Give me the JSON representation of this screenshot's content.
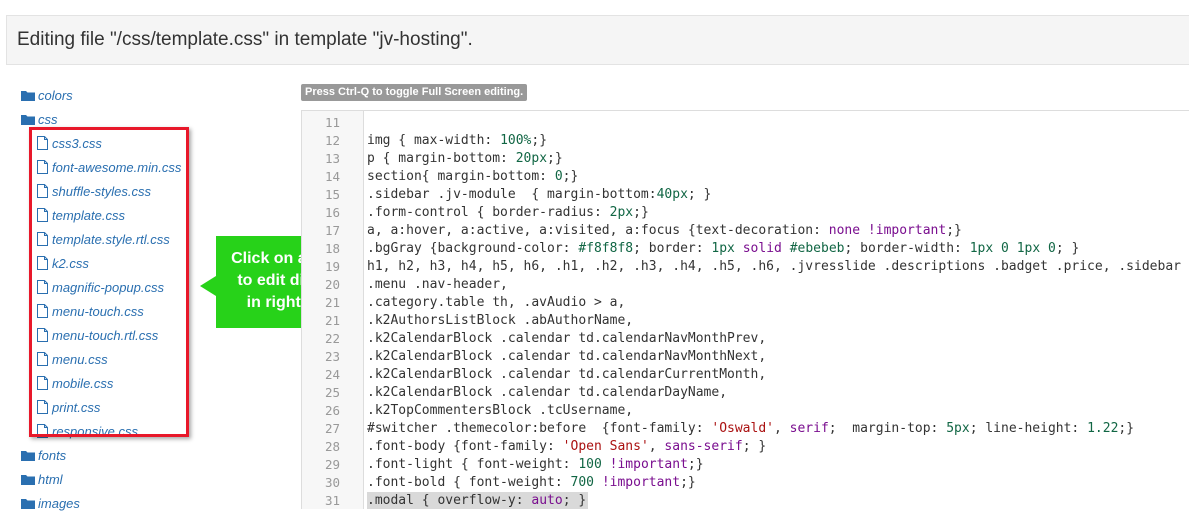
{
  "header": {
    "title": "Editing file \"/css/template.css\" in template \"jv-hosting\"."
  },
  "tree": {
    "folders_top": [
      {
        "label": "colors"
      },
      {
        "label": "css"
      }
    ],
    "css_files": [
      "css3.css",
      "font-awesome.min.css",
      "shuffle-styles.css",
      "template.css",
      "template.style.rtl.css",
      "k2.css",
      "magnific-popup.css",
      "menu-touch.css",
      "menu-touch.rtl.css",
      "menu.css",
      "mobile.css",
      "print.css",
      "responsive.css"
    ],
    "folders_bottom": [
      {
        "label": "fonts"
      },
      {
        "label": "html"
      },
      {
        "label": "images"
      }
    ]
  },
  "callout": {
    "line1": "Click on any file",
    "line2": "to edit directly",
    "line3": "in right side"
  },
  "editor": {
    "hint": "Press Ctrl-Q to toggle Full Screen editing.",
    "lines": [
      {
        "n": "11",
        "code": ""
      },
      {
        "n": "12",
        "code": "img { max-width: 100%;}"
      },
      {
        "n": "13",
        "code": "p { margin-bottom: 20px;}"
      },
      {
        "n": "14",
        "code": "section{ margin-bottom: 0;}"
      },
      {
        "n": "15",
        "code": ".sidebar .jv-module  { margin-bottom:40px; }"
      },
      {
        "n": "16",
        "code": ".form-control { border-radius: 2px;}"
      },
      {
        "n": "17",
        "code": "a, a:hover, a:active, a:visited, a:focus {text-decoration: none !important;}"
      },
      {
        "n": "18",
        "code": ".bgGray {background-color: #f8f8f8; border: 1px solid #ebebeb; border-width: 1px 0 1px 0; }"
      },
      {
        "n": "19",
        "code": "h1, h2, h3, h4, h5, h6, .h1, .h2, .h3, .h4, .h5, .h6, .jvresslide .descriptions .badget .price, .sidebar"
      },
      {
        "n": "20",
        "code": ".menu .nav-header,"
      },
      {
        "n": "21",
        "code": ".category.table th, .avAudio > a,"
      },
      {
        "n": "21",
        "code": ".k2AuthorsListBlock .abAuthorName,"
      },
      {
        "n": "22",
        "code": ".k2CalendarBlock .calendar td.calendarNavMonthPrev,"
      },
      {
        "n": "23",
        "code": ".k2CalendarBlock .calendar td.calendarNavMonthNext,"
      },
      {
        "n": "24",
        "code": ".k2CalendarBlock .calendar td.calendarCurrentMonth,"
      },
      {
        "n": "25",
        "code": ".k2CalendarBlock .calendar td.calendarDayName,"
      },
      {
        "n": "26",
        "code": ".k2TopCommentersBlock .tcUsername,"
      },
      {
        "n": "27",
        "code": "#switcher .themecolor:before  {font-family: 'Oswald', serif;  margin-top: 5px; line-height: 1.22;}"
      },
      {
        "n": "28",
        "code": ".font-body {font-family: 'Open Sans', sans-serif; }"
      },
      {
        "n": "29",
        "code": ".font-light { font-weight: 100 !important;}"
      },
      {
        "n": "30",
        "code": ".font-bold { font-weight: 700 !important;}"
      },
      {
        "n": "31",
        "code": ".modal { overflow-y: auto; }"
      }
    ]
  },
  "colors": {
    "link": "#2a6fb0",
    "folder_icon": "#2a6fb0",
    "highlight_border": "#e8182a",
    "callout_bg": "#27d219",
    "active_line": "#d9d9d9"
  }
}
